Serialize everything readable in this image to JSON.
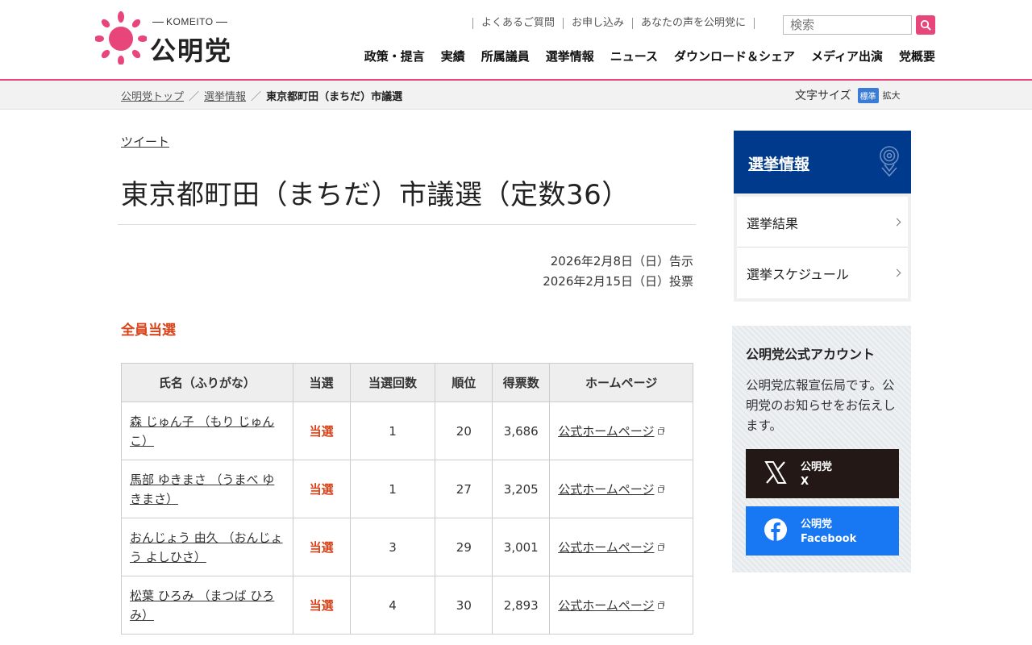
{
  "header": {
    "logo_sub": "KOMEITO",
    "logo_text": "公明党",
    "util_links": [
      "よくあるご質問",
      "お申し込み",
      "あなたの声を公明党に"
    ],
    "search_placeholder": "検索",
    "nav": [
      "政策・提言",
      "実績",
      "所属議員",
      "選挙情報",
      "ニュース",
      "ダウンロード＆シェア",
      "メディア出演",
      "党概要"
    ]
  },
  "breadcrumb": {
    "items": [
      "公明党トップ",
      "選挙情報"
    ],
    "current": "東京都町田（まちだ）市議選",
    "sep": "／"
  },
  "fontsize": {
    "label": "文字サイズ",
    "standard": "標準",
    "large": "拡大"
  },
  "main": {
    "tweet": "ツイート",
    "title": "東京都町田（まちだ）市議選（定数36）",
    "date_notice": "2026年2月8日（日）告示",
    "date_vote": "2026年2月15日（日）投票",
    "result_summary": "全員当選"
  },
  "table": {
    "headers": [
      "氏名（ふりがな）",
      "当選",
      "当選回数",
      "順位",
      "得票数",
      "ホームページ"
    ],
    "rows": [
      {
        "name": "森 じゅん子 （もり じゅんこ）",
        "result": "当選",
        "times": "1",
        "rank": "20",
        "votes": "3,686",
        "hp": "公式ホームページ"
      },
      {
        "name": "馬部 ゆきまさ （うまべ ゆきまさ）",
        "result": "当選",
        "times": "1",
        "rank": "27",
        "votes": "3,205",
        "hp": "公式ホームページ"
      },
      {
        "name": "おんじょう 由久 （おんじょう よしひさ）",
        "result": "当選",
        "times": "3",
        "rank": "29",
        "votes": "3,001",
        "hp": "公式ホームページ"
      },
      {
        "name": "松葉 ひろみ （まつば ひろみ）",
        "result": "当選",
        "times": "4",
        "rank": "30",
        "votes": "2,893",
        "hp": "公式ホームページ"
      }
    ]
  },
  "sidebar": {
    "election_title": "選挙情報",
    "election_items": [
      "選挙結果",
      "選挙スケジュール"
    ],
    "account_title": "公明党公式アカウント",
    "account_desc": "公明党広報宣伝局です。公明党のお知らせをお伝えします。",
    "x_line1": "公明党",
    "x_line2": "X",
    "fb_line1": "公明党",
    "fb_line2": "Facebook"
  },
  "colors": {
    "brand_pink": "#e8457a",
    "navy": "#003a8c",
    "win_red": "#d9431a",
    "x_black": "#231815",
    "fb_blue": "#1877f2"
  },
  "icons": [
    "komeito-logo-icon",
    "search-icon",
    "rose-icon",
    "chevron-right-icon",
    "external-link-icon",
    "x-logo-icon",
    "facebook-logo-icon"
  ]
}
